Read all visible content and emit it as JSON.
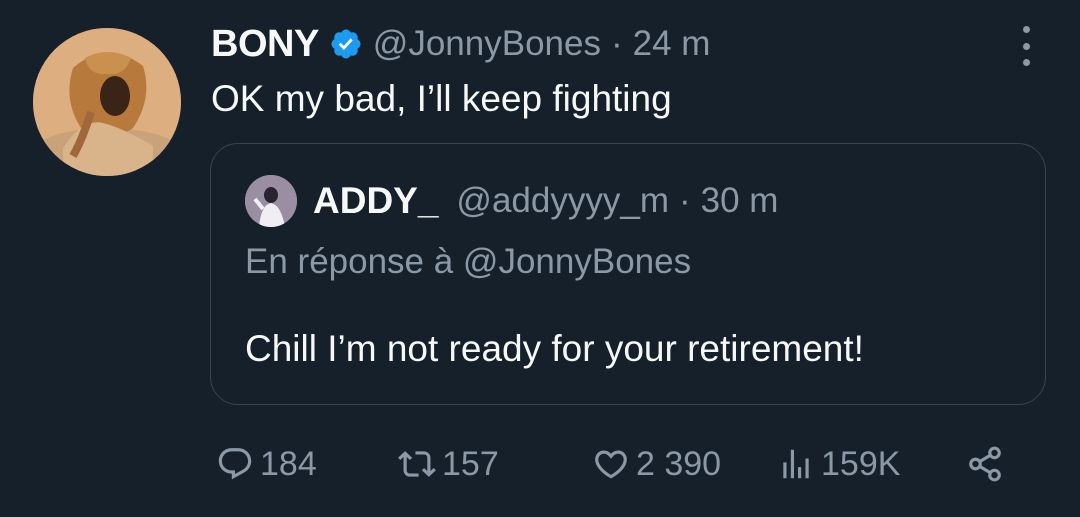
{
  "tweet": {
    "author": {
      "name": "BONY",
      "handle": "@JonnyBones",
      "verified": true
    },
    "separator": "·",
    "time": "24 m",
    "text": "OK my bad, I’ll keep fighting",
    "more_icon": "more-vertical-icon"
  },
  "quote": {
    "author": {
      "name": "ADDY_",
      "handle": "@addyyyy_m"
    },
    "separator": "·",
    "time": "30 m",
    "reply_to": "En réponse à @JonnyBones",
    "text": "Chill I’m not ready for your retirement!"
  },
  "actions": {
    "replies": "184",
    "retweets": "157",
    "likes": "2 390",
    "views": "159K"
  },
  "colors": {
    "background": "#15202b",
    "primary_text": "#f7f9f9",
    "secondary_text": "#8b98a5",
    "border": "#38444d",
    "verified_badge": "#1d9bf0"
  }
}
